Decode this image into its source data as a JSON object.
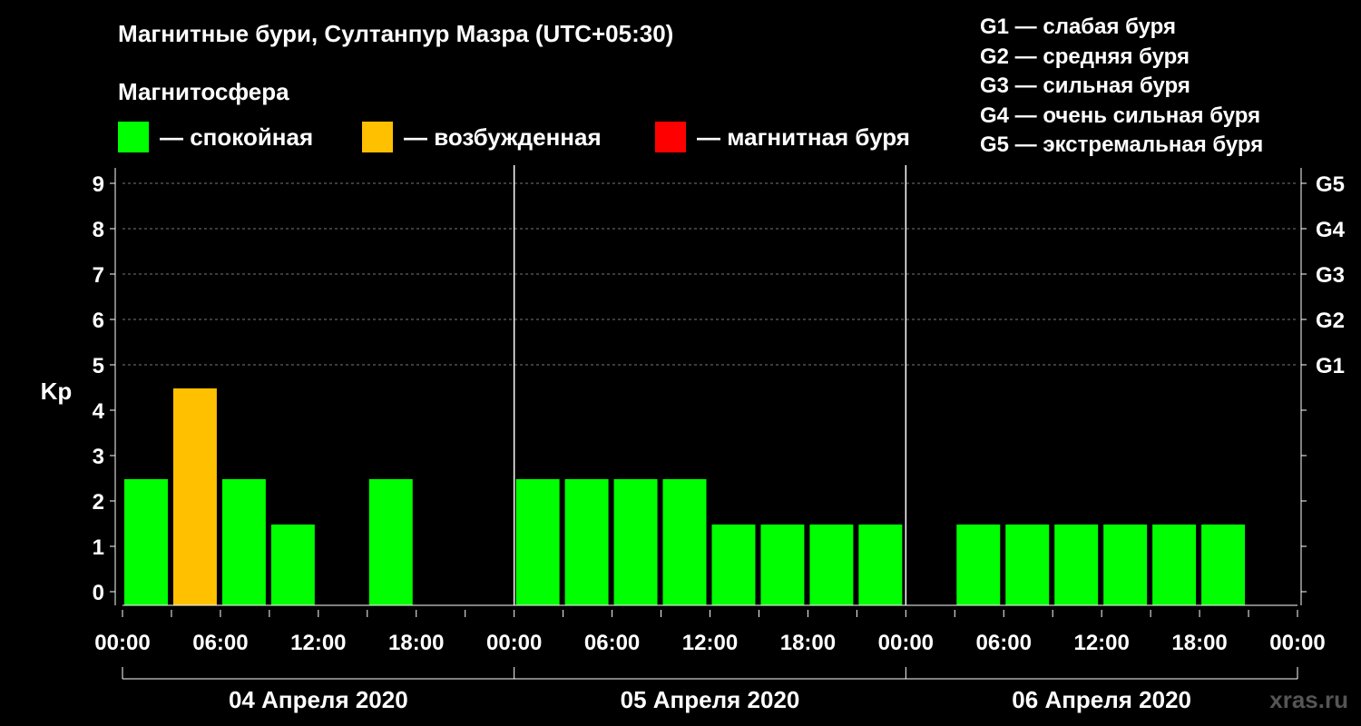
{
  "header": {
    "title": "Магнитные бури, Султанпур Мазра (UTC+05:30)",
    "subtitle": "Магнитосфера"
  },
  "legend": [
    {
      "label": "— спокойная",
      "color": "#00ff00"
    },
    {
      "label": "— возбужденная",
      "color": "#ffc000"
    },
    {
      "label": "— магнитная буря",
      "color": "#ff0000"
    }
  ],
  "g_scale": [
    "G1 — слабая буря",
    "G2 — средняя буря",
    "G3 — сильная буря",
    "G4 — очень сильная буря",
    "G5 — экстремальная буря"
  ],
  "watermark": "xras.ru",
  "chart_data": {
    "type": "bar",
    "ylabel": "Kp",
    "ylim": [
      0,
      9
    ],
    "yticks": [
      "0",
      "1",
      "2",
      "3",
      "4",
      "5",
      "6",
      "7",
      "8",
      "9"
    ],
    "right_ticks": [
      {
        "kp": 5,
        "label": "G1"
      },
      {
        "kp": 6,
        "label": "G2"
      },
      {
        "kp": 7,
        "label": "G3"
      },
      {
        "kp": 8,
        "label": "G4"
      },
      {
        "kp": 9,
        "label": "G5"
      }
    ],
    "xtick_labels": [
      "00:00",
      "06:00",
      "12:00",
      "18:00",
      "00:00",
      "06:00",
      "12:00",
      "18:00",
      "00:00",
      "06:00",
      "12:00",
      "18:00",
      "00:00"
    ],
    "days": [
      "04 Апреля 2020",
      "05 Апреля 2020",
      "06 Апреля 2020"
    ],
    "grid": true,
    "bars": [
      {
        "day": 0,
        "slot": 0,
        "kp": 2,
        "status": "calm"
      },
      {
        "day": 0,
        "slot": 1,
        "kp": 4,
        "status": "excited"
      },
      {
        "day": 0,
        "slot": 2,
        "kp": 2,
        "status": "calm"
      },
      {
        "day": 0,
        "slot": 3,
        "kp": 1,
        "status": "calm"
      },
      {
        "day": 0,
        "slot": 5,
        "kp": 2,
        "status": "calm"
      },
      {
        "day": 1,
        "slot": 0,
        "kp": 2,
        "status": "calm"
      },
      {
        "day": 1,
        "slot": 1,
        "kp": 2,
        "status": "calm"
      },
      {
        "day": 1,
        "slot": 2,
        "kp": 2,
        "status": "calm"
      },
      {
        "day": 1,
        "slot": 3,
        "kp": 2,
        "status": "calm"
      },
      {
        "day": 1,
        "slot": 4,
        "kp": 1,
        "status": "calm"
      },
      {
        "day": 1,
        "slot": 5,
        "kp": 1,
        "status": "calm"
      },
      {
        "day": 1,
        "slot": 6,
        "kp": 1,
        "status": "calm"
      },
      {
        "day": 1,
        "slot": 7,
        "kp": 1,
        "status": "calm"
      },
      {
        "day": 2,
        "slot": 1,
        "kp": 1,
        "status": "calm"
      },
      {
        "day": 2,
        "slot": 2,
        "kp": 1,
        "status": "calm"
      },
      {
        "day": 2,
        "slot": 3,
        "kp": 1,
        "status": "calm"
      },
      {
        "day": 2,
        "slot": 4,
        "kp": 1,
        "status": "calm"
      },
      {
        "day": 2,
        "slot": 5,
        "kp": 1,
        "status": "calm"
      },
      {
        "day": 2,
        "slot": 6,
        "kp": 1,
        "status": "calm"
      }
    ],
    "status_colors": {
      "calm": "#00ff00",
      "excited": "#ffc000",
      "storm": "#ff0000"
    }
  }
}
